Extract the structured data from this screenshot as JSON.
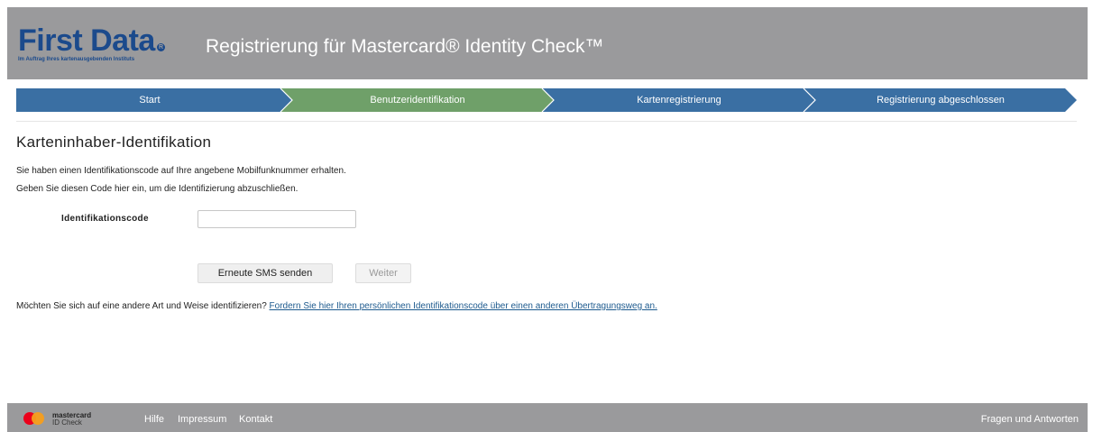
{
  "header": {
    "brand_name": "First Data",
    "brand_tagline": "Im Auftrag Ihres kartenausgebenden Instituts",
    "title": "Registrierung für Mastercard® Identity Check™"
  },
  "steps": [
    {
      "label": "Start",
      "status": "done"
    },
    {
      "label": "Benutzeridentifikation",
      "status": "active"
    },
    {
      "label": "Kartenregistrierung",
      "status": "pending"
    },
    {
      "label": "Registrierung abgeschlossen",
      "status": "pending"
    }
  ],
  "colors": {
    "step_blue": "#3a6fa3",
    "step_green": "#6fa069",
    "header_gray": "#9a9a9c",
    "link": "#1d5a8e"
  },
  "main": {
    "heading": "Karteninhaber-Identifikation",
    "paragraph1": "Sie haben einen Identifikationscode auf Ihre angebene Mobilfunknummer erhalten.",
    "paragraph2": "Geben Sie diesen Code hier ein, um die Identifizierung abzuschließen.",
    "code_label": "Identifikationscode",
    "code_value": "",
    "resend_label": "Erneute SMS senden",
    "next_label": "Weiter",
    "alt_question": "Möchten Sie sich auf eine andere Art und Weise identifizieren?",
    "alt_link": "Fordern Sie hier Ihren persönlichen Identifikationscode über einen anderen Übertragungsweg an."
  },
  "footer": {
    "logo_line1": "mastercard",
    "logo_line2": "ID Check",
    "links": [
      "Hilfe",
      "Impressum",
      "Kontakt"
    ],
    "faq": "Fragen und Antworten"
  }
}
